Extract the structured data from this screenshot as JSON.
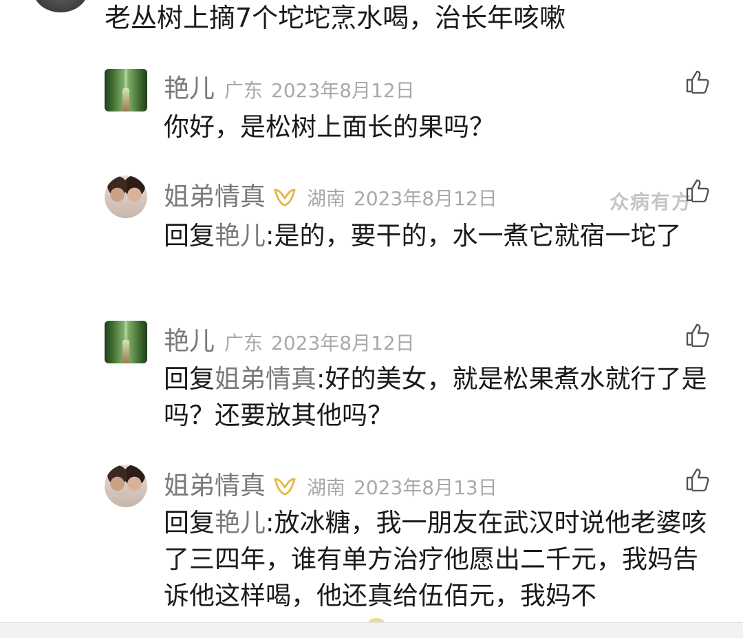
{
  "top_comment": {
    "text": "老丛树上摘7个坨坨烹水喝，治长年咳嗽"
  },
  "watermark": "众病有方",
  "comments": [
    {
      "name": "艳儿",
      "location": "广东",
      "date": "2023年8月12日",
      "reply_prefix": "",
      "reply_target": "",
      "text": "你好，是松树上面长的果吗？"
    },
    {
      "name": "姐弟情真",
      "location": "湖南",
      "date": "2023年8月12日",
      "reply_prefix": "回复",
      "reply_target": "艳儿",
      "text": ":是的，要干的，水一煮它就宿一坨了"
    },
    {
      "name": "艳儿",
      "location": "广东",
      "date": "2023年8月12日",
      "reply_prefix": "回复",
      "reply_target": "姐弟情真",
      "text": ":好的美女，就是松果煮水就行了是吗？还要放其他吗？"
    },
    {
      "name": "姐弟情真",
      "location": "湖南",
      "date": "2023年8月13日",
      "reply_prefix": "回复",
      "reply_target": "艳儿",
      "text": ":放冰糖，我一朋友在武汉时说他老婆咳了三四年，谁有单方治疗他愿出二千元，我妈告诉他这样喝，他还真给伍佰元，我妈不"
    }
  ],
  "icons": {
    "like": "thumbs-up-icon",
    "badge": "gold-ribbon-badge-icon"
  },
  "colors": {
    "name": "#7a7a7a",
    "meta": "#a9a9a9",
    "badge": "#e5b84a",
    "text": "#1a1a1a"
  }
}
